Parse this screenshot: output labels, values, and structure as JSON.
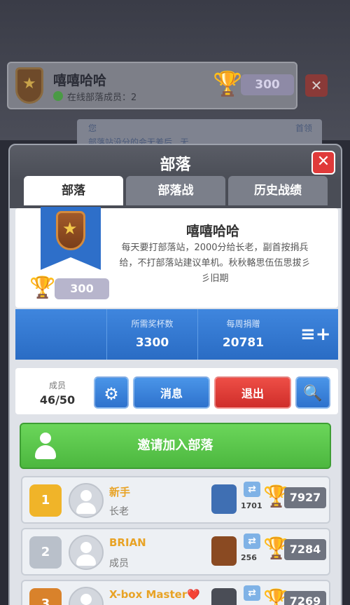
{
  "background": {
    "clan_name": "嘻嘻哈哈",
    "online_text": "在线部落成员：2",
    "trophies": "300",
    "close_label": "✕",
    "chat_user": "您",
    "chat_tag": "首领",
    "chat_message": "部落站没分的会无差后...无"
  },
  "panel": {
    "title": "部落",
    "close_label": "✕",
    "tabs": [
      "部落",
      "部落战",
      "历史战绩"
    ]
  },
  "clan": {
    "name": "嘻嘻哈哈",
    "description": "每天要打部落站，2000分给长老，副首按捐兵给，不打部落站建议单机。秋秋輅思伍伍思拔彡彡旧期",
    "trophies": "300"
  },
  "stats": {
    "required_label": "所需奖杯数",
    "required_value": "3300",
    "weekly_label": "每周捐赠",
    "weekly_value": "20781",
    "sort_icon": "sort-icon"
  },
  "actions": {
    "members_label": "成员",
    "members_count": "46/50",
    "settings_icon": "gear-icon",
    "message_label": "消息",
    "leave_label": "退出",
    "search_icon": "search-icon"
  },
  "invite": {
    "label": "邀请加入部落"
  },
  "members": [
    {
      "rank": "1",
      "name": "新手",
      "role": "长老",
      "donations": "1701",
      "trophies": "7927",
      "rank_color": "#f0b429",
      "arena_color": "#3f6fb3"
    },
    {
      "rank": "2",
      "name": "BRIAN",
      "role": "成员",
      "donations": "256",
      "trophies": "7284",
      "rank_color": "#b9c0ca",
      "arena_color": "#8a4a22"
    },
    {
      "rank": "3",
      "name": "X-box Master❤️",
      "role": "",
      "donations": "",
      "trophies": "7269",
      "rank_color": "#d9822b",
      "arena_color": "#4a4d56"
    }
  ],
  "colors": {
    "accent_blue": "#2e72cd",
    "accent_red": "#e03a3a",
    "accent_green": "#4cb73f",
    "gold": "#f2a71b"
  }
}
